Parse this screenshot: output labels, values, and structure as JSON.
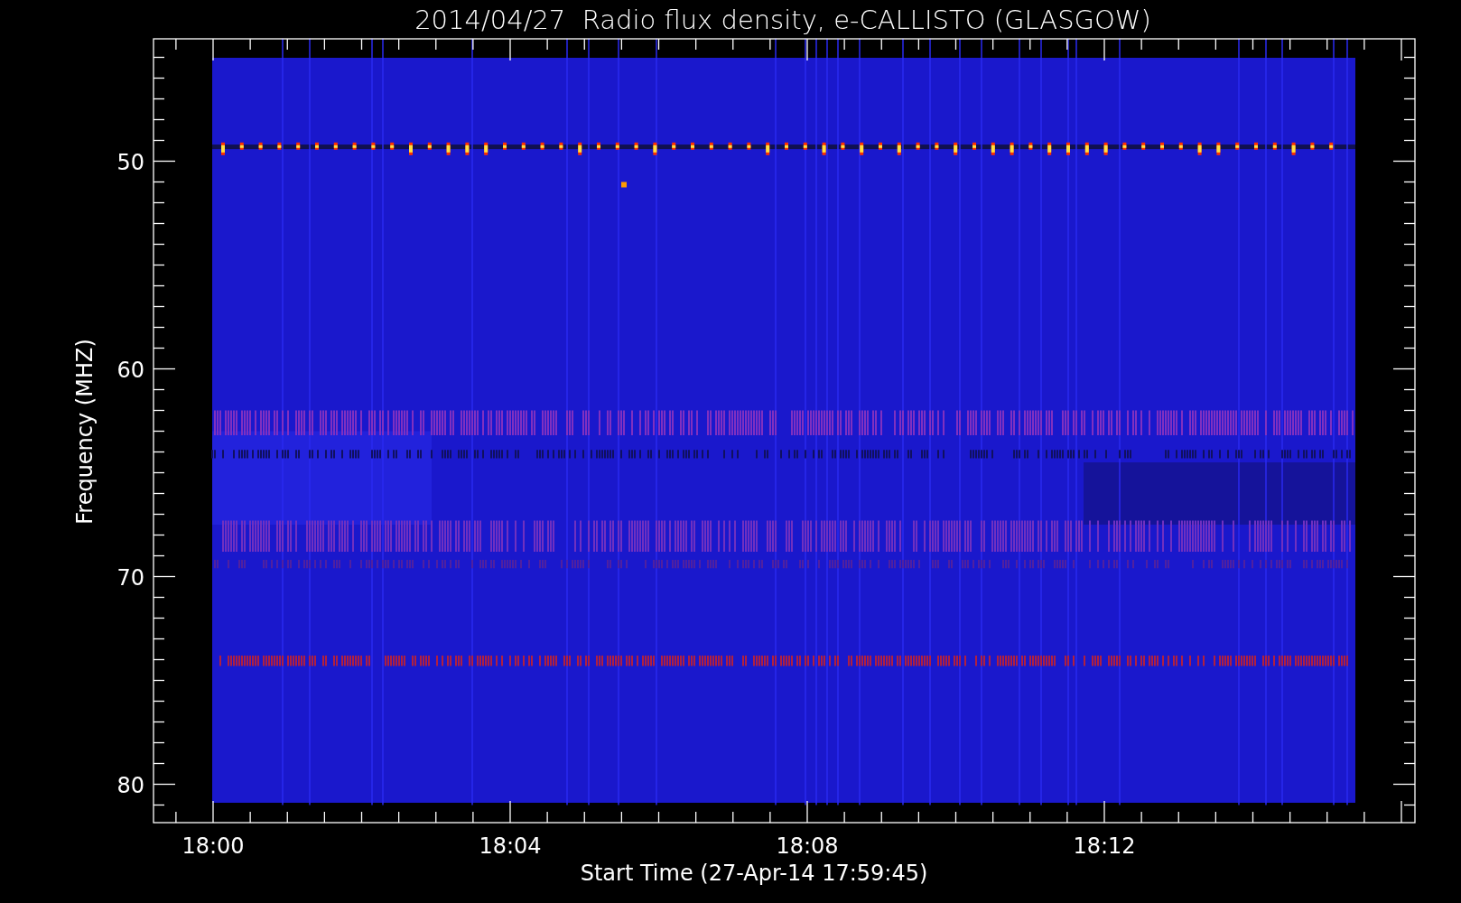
{
  "plot": {
    "title": "2014/04/27  Radio flux density, e-CALLISTO (GLASGOW)",
    "xlabel": "Start Time (27-Apr-14 17:59:45)",
    "ylabel": "Frequency (MHZ)",
    "x_tick_labels": [
      "18:00",
      "18:04",
      "18:08",
      "18:12"
    ],
    "y_tick_labels": [
      "50",
      "60",
      "70",
      "80"
    ]
  }
}
